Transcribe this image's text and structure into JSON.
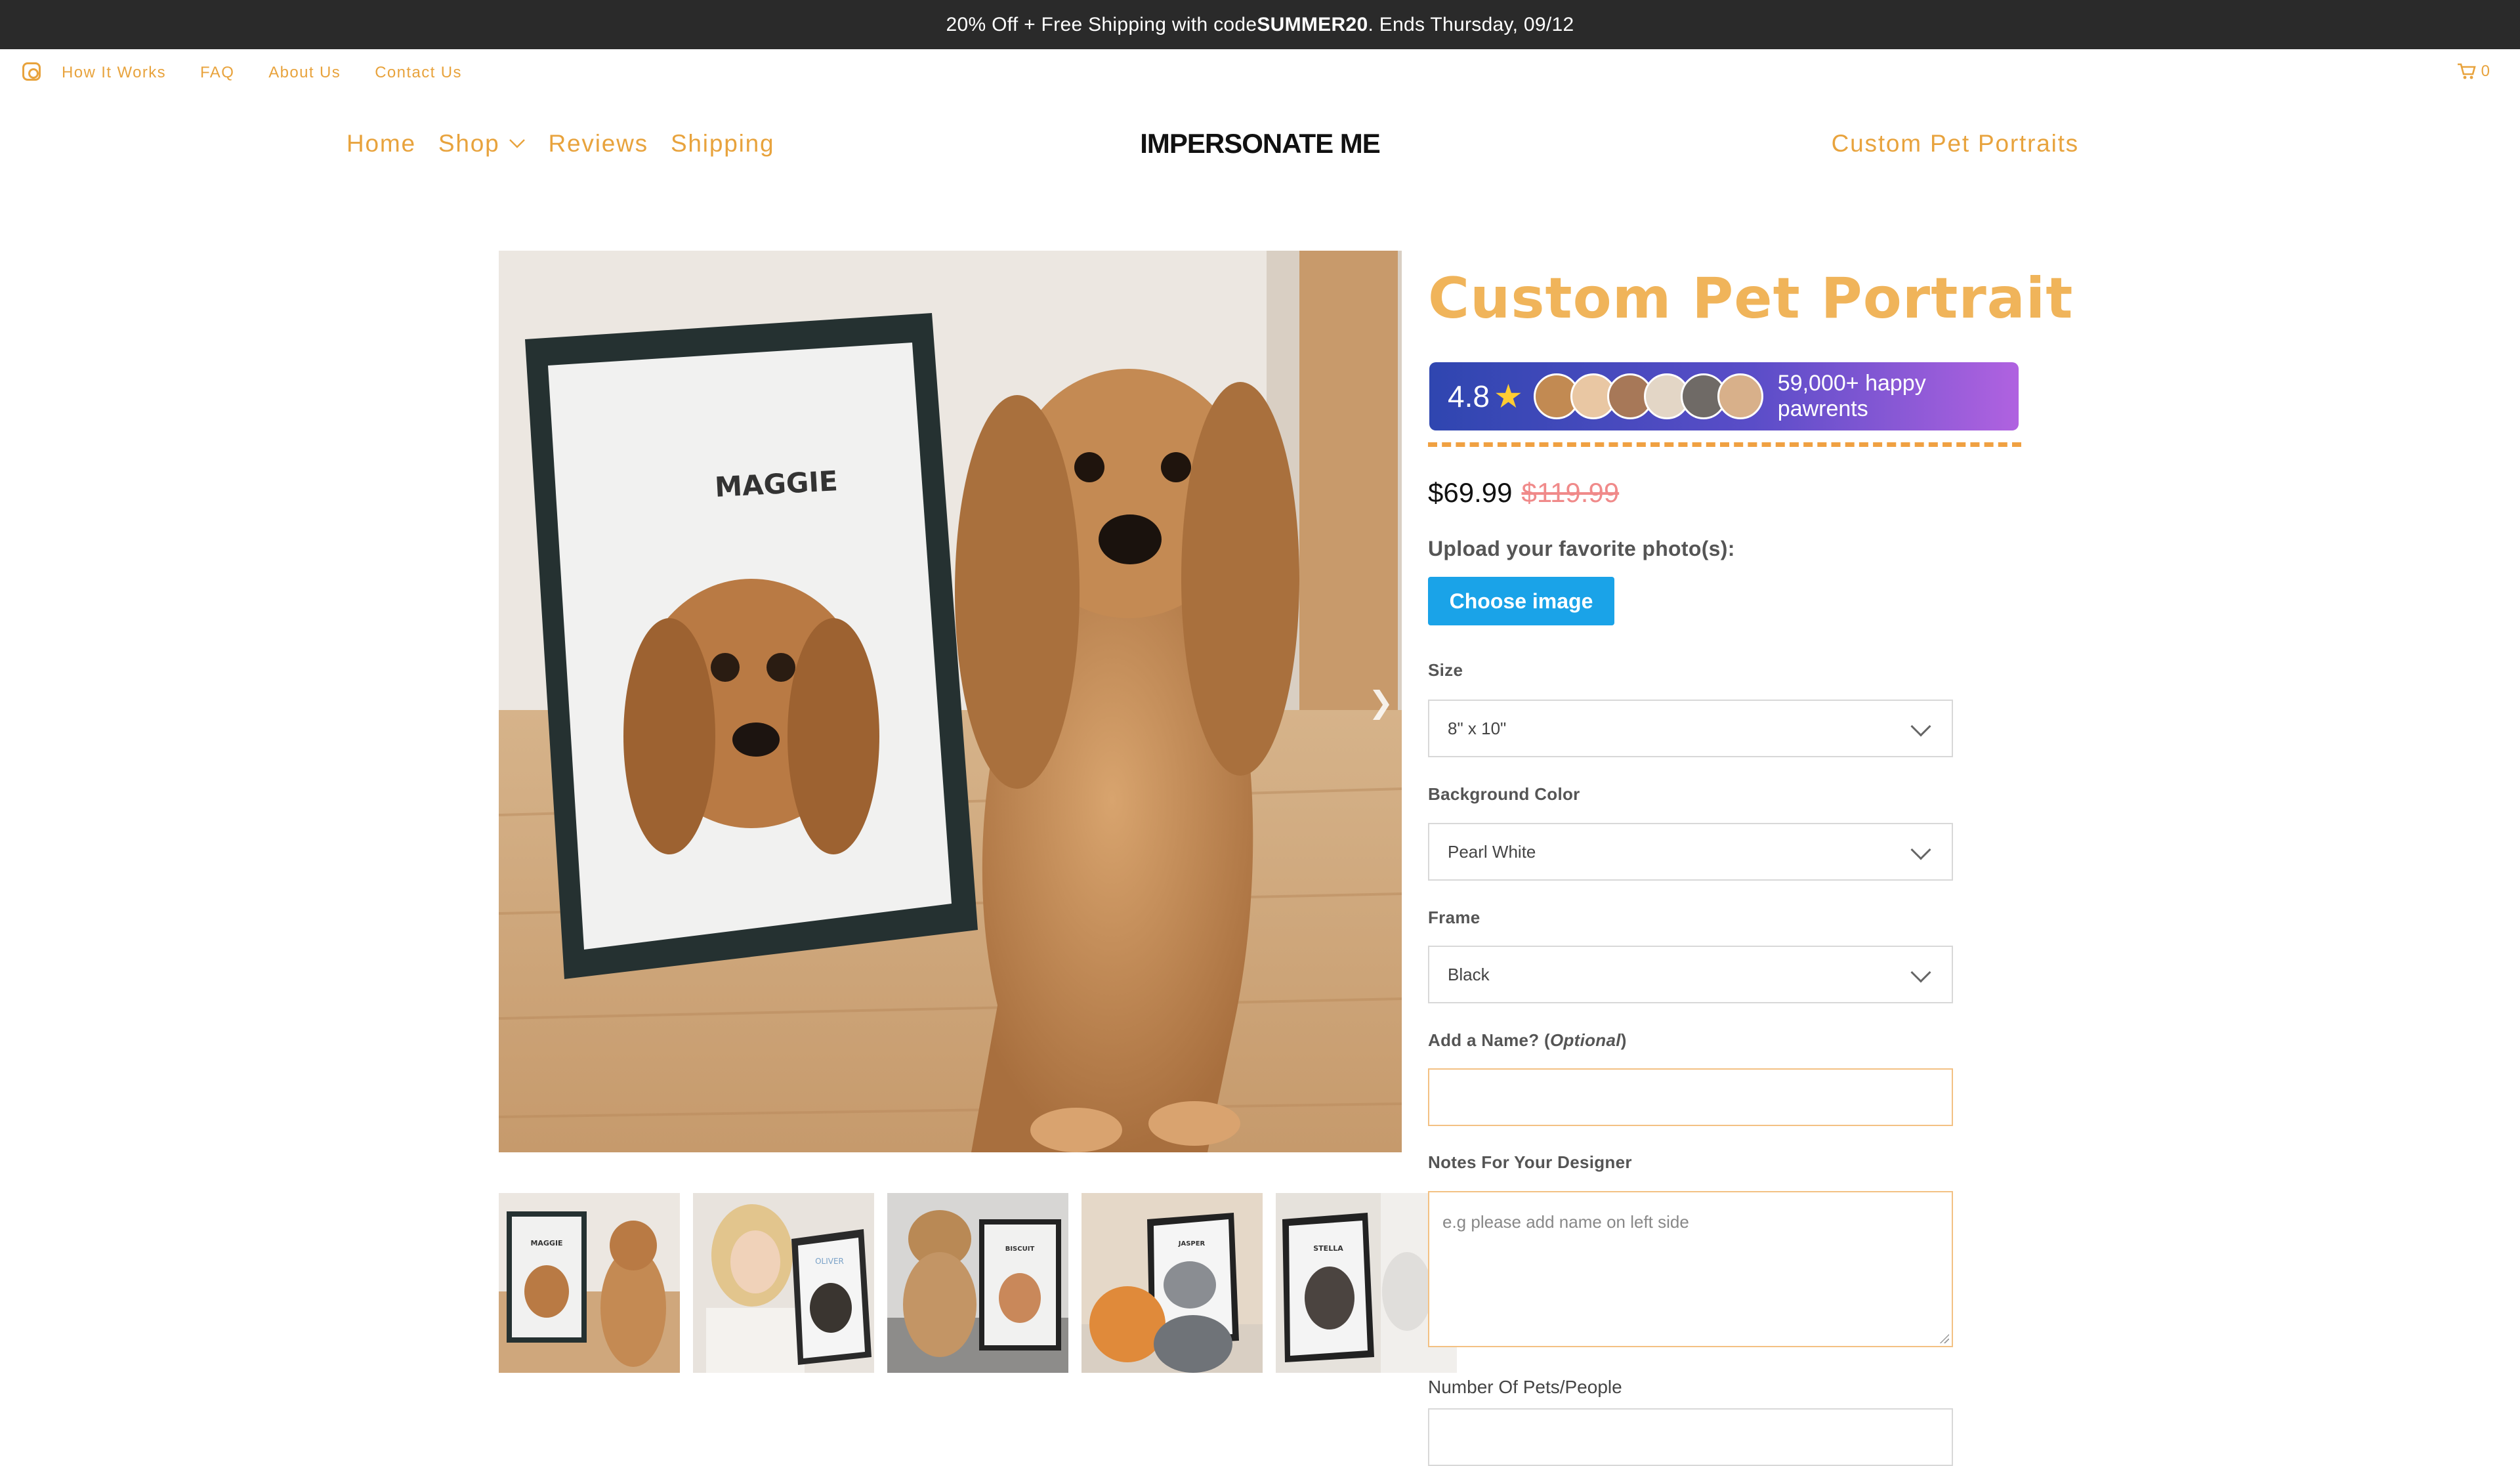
{
  "promo": {
    "pre": "20% Off + Free Shipping with code ",
    "code": "SUMMER20",
    "post": ". Ends Thursday, 09/12"
  },
  "utility": {
    "links": [
      "How It Works",
      "FAQ",
      "About Us",
      "Contact Us"
    ],
    "cart_count": "0",
    "social_icon": "instagram-icon",
    "cart_icon": "cart-icon"
  },
  "nav": {
    "left": [
      "Home",
      "Shop",
      "Reviews",
      "Shipping"
    ],
    "logo": "IMPERSONATE ME",
    "right": "Custom Pet Portraits"
  },
  "gallery": {
    "frame_name": "MAGGIE",
    "thumbs": [
      "MAGGIE",
      "OLIVER",
      "BISCUIT",
      "JASPER",
      "STELLA"
    ]
  },
  "product": {
    "title": "Custom Pet Portrait",
    "rating": {
      "score": "4.8",
      "count_text": "59,000+ happy pawrents"
    },
    "price": "$69.99",
    "compare_price": "$119.99",
    "upload_label": "Upload your favorite photo(s):",
    "choose_label": "Choose image",
    "size": {
      "label": "Size",
      "value": "8\" x 10\""
    },
    "background": {
      "label": "Background Color",
      "value": "Pearl White"
    },
    "frame": {
      "label": "Frame",
      "value": "Black"
    },
    "name": {
      "label_pre": "Add a Name? (",
      "label_em": "Optional",
      "label_post": ")",
      "value": ""
    },
    "notes": {
      "label": "Notes For Your Designer",
      "placeholder": "e.g please add name on left side"
    },
    "pets": {
      "label": "Number Of Pets/People"
    }
  },
  "colors": {
    "accent": "#e8a33d",
    "title": "#f0b45a",
    "button": "#1aa3e8",
    "banner": "#2a2a2a",
    "compare": "#f08a8a"
  }
}
